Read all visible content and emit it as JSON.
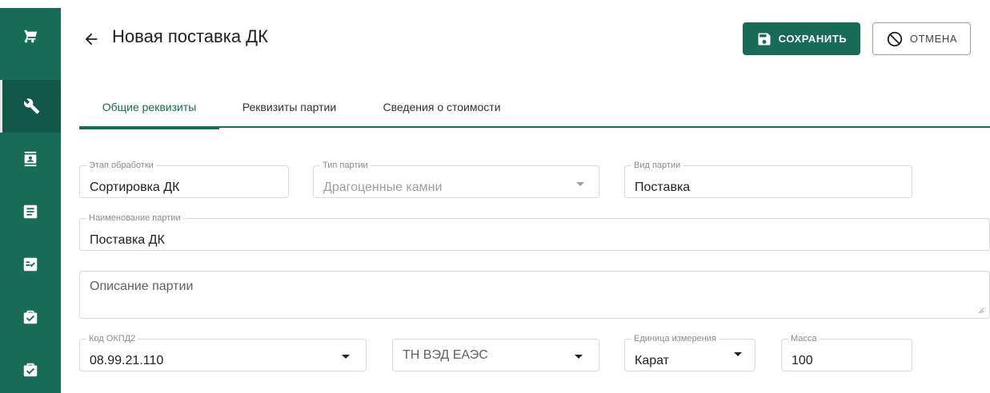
{
  "sidebar": {
    "items": [
      {
        "icon": "cart-icon"
      },
      {
        "icon": "tools-icon",
        "active": true
      },
      {
        "icon": "contact-card-icon"
      },
      {
        "icon": "list-document-icon"
      },
      {
        "icon": "checked-list-icon"
      },
      {
        "icon": "briefcase-check-icon"
      },
      {
        "icon": "briefcase-check-icon"
      }
    ]
  },
  "header": {
    "title": "Новая поставка ДК",
    "save_label": "СОХРАНИТЬ",
    "cancel_label": "ОТМЕНА"
  },
  "tabs": [
    {
      "label": "Общие реквизиты",
      "active": true
    },
    {
      "label": "Реквизиты партии",
      "active": false
    },
    {
      "label": "Сведения о стоимости",
      "active": false
    }
  ],
  "form": {
    "stage": {
      "label": "Этап обработки",
      "value": "Сортировка ДК"
    },
    "batch_type": {
      "label": "Тип партии",
      "value": "Драгоценные камни"
    },
    "batch_kind": {
      "label": "Вид партии",
      "value": "Поставка"
    },
    "batch_name": {
      "label": "Наименование партии",
      "value": "Поставка ДК"
    },
    "description": {
      "placeholder": "Описание партии"
    },
    "okpd2": {
      "label": "Код ОКПД2",
      "value": "08.99.21.110"
    },
    "tn_ved": {
      "placeholder": "ТН ВЭД ЕАЭС"
    },
    "unit": {
      "label": "Единица измерения",
      "value": "Карат"
    },
    "mass": {
      "label": "Масса",
      "value": "100"
    }
  },
  "colors": {
    "accent": "#186b57"
  }
}
